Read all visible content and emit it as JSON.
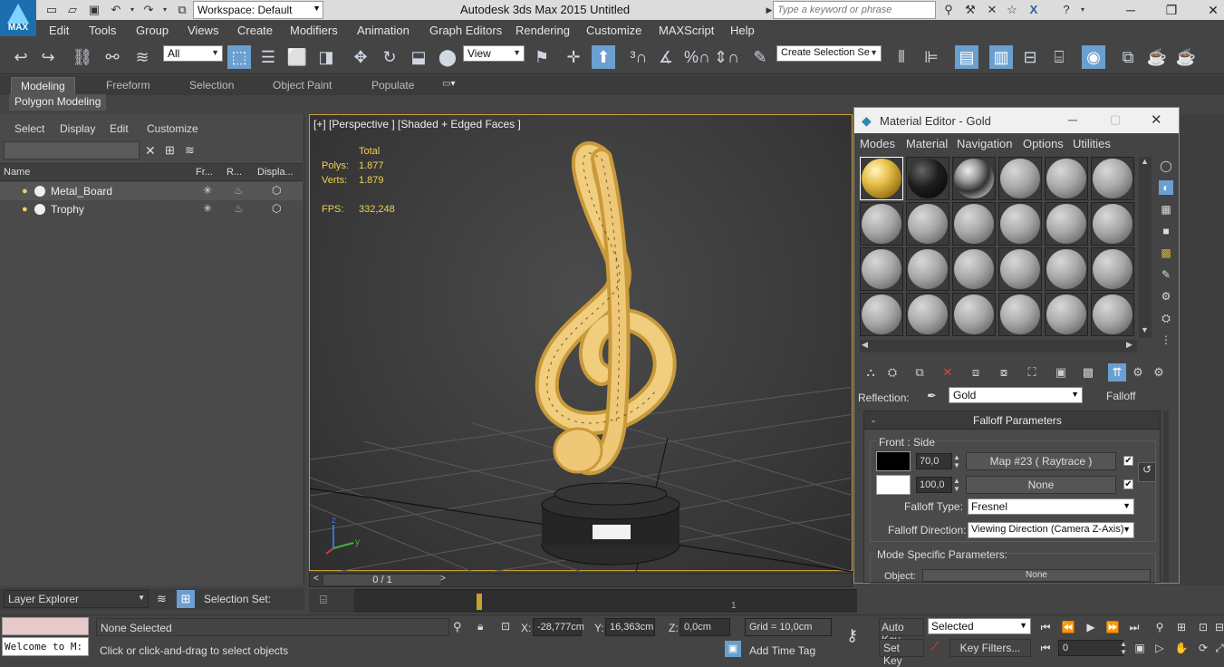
{
  "app": {
    "logo_text": "MAX",
    "title": "Autodesk 3ds Max  2015     Untitled",
    "workspace": "Workspace: Default",
    "search_placeholder": "Type a keyword or phrase"
  },
  "menu": [
    "Edit",
    "Tools",
    "Group",
    "Views",
    "Create",
    "Modifiers",
    "Animation",
    "Graph Editors",
    "Rendering",
    "Customize",
    "MAXScript",
    "Help"
  ],
  "toolbar": {
    "selection_filter": "All",
    "reference_coord": "View",
    "named_selection_placeholder": "Create Selection Se"
  },
  "ribbon": {
    "tabs": [
      "Modeling",
      "Freeform",
      "Selection",
      "Object Paint",
      "Populate"
    ],
    "panel": "Polygon Modeling"
  },
  "scene_explorer": {
    "menu": [
      "Select",
      "Display",
      "Edit",
      "Customize"
    ],
    "columns": [
      "Name",
      "Fr...",
      "R...",
      "Displa..."
    ],
    "rows": [
      {
        "name": "Metal_Board"
      },
      {
        "name": "Trophy"
      }
    ],
    "footer_combo": "Layer Explorer",
    "selection_set_label": "Selection Set:"
  },
  "viewport": {
    "label": "[+] [Perspective ] [Shaded + Edged Faces ]",
    "stats_header": "Total",
    "polys_label": "Polys:",
    "polys": "1.877",
    "verts_label": "Verts:",
    "verts": "1.879",
    "fps_label": "FPS:",
    "fps": "332,248",
    "axis_z": "z",
    "axis_y": "y"
  },
  "material_editor": {
    "title": "Material Editor - Gold",
    "menu": [
      "Modes",
      "Material",
      "Navigation",
      "Options",
      "Utilities"
    ],
    "reflection_label": "Reflection:",
    "reflection_map": "Gold",
    "map_type": "Falloff",
    "rollout_title": "Falloff Parameters",
    "rollout_collapse": "-",
    "front_side_label": "Front : Side",
    "front_amount": "70,0",
    "front_map": "Map #23  ( Raytrace )",
    "side_amount": "100,0",
    "side_map": "None",
    "falloff_type_label": "Falloff Type:",
    "falloff_type": "Fresnel",
    "falloff_direction_label": "Falloff Direction:",
    "falloff_direction": "Viewing Direction (Camera Z-Axis)",
    "mode_specific_label": "Mode Specific Parameters:",
    "object_label": "Object:",
    "object_value": "None",
    "colors": {
      "front": "#000000",
      "side": "#ffffff"
    }
  },
  "timeline": {
    "frame": "0 / 1",
    "tick_1": "1"
  },
  "status": {
    "listener_text": "Welcome to M:",
    "selection": "None Selected",
    "prompt": "Click or click-and-drag to select objects",
    "x_label": "X:",
    "x": "-28,777cm",
    "y_label": "Y:",
    "y": "16,363cm",
    "z_label": "Z:",
    "z": "0,0cm",
    "grid": "Grid = 10,0cm",
    "add_time_tag": "Add Time Tag",
    "auto_key": "Auto Key",
    "set_key": "Set Key",
    "key_mode": "Selected",
    "key_filters": "Key Filters...",
    "current_frame": "0"
  }
}
